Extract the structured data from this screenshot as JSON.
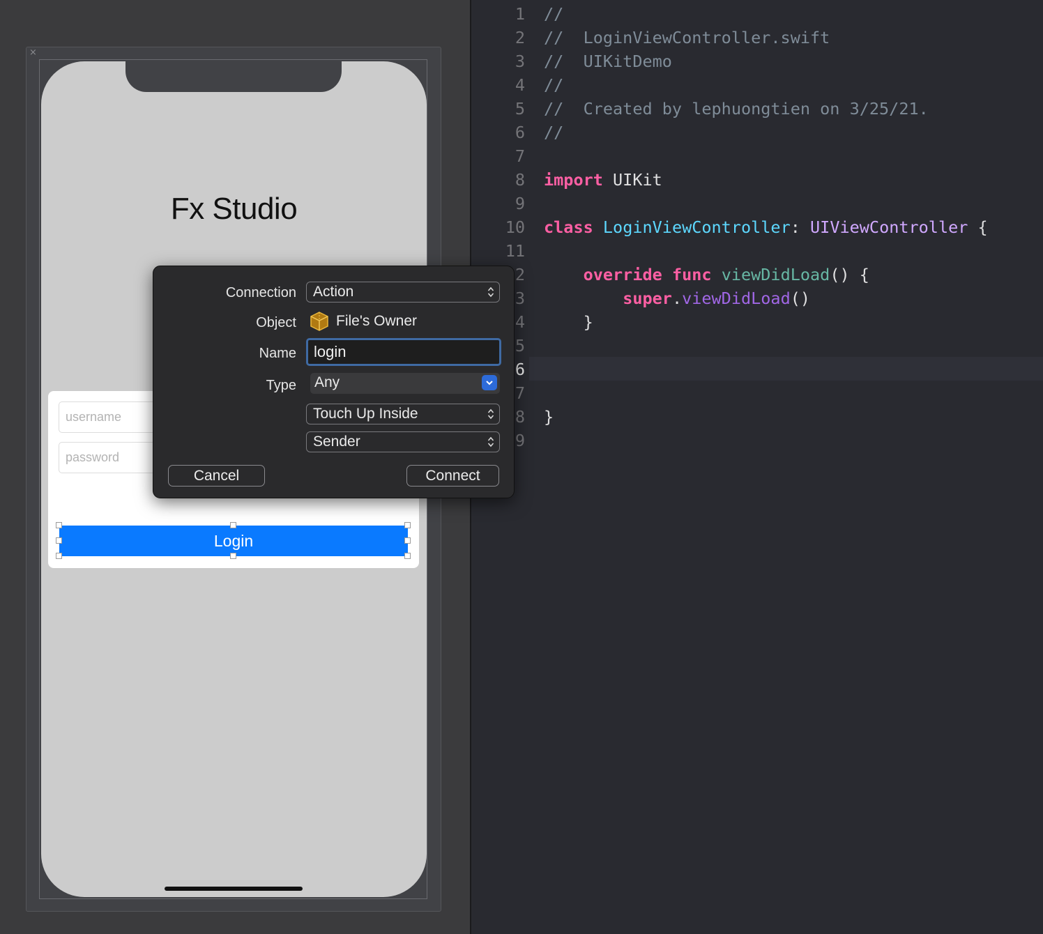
{
  "canvas": {
    "app_title": "Fx Studio",
    "username_placeholder": "username",
    "password_placeholder": "password",
    "login_label": "Login",
    "scene_close_glyph": "×"
  },
  "popover": {
    "connection_label": "Connection",
    "connection_value": "Action",
    "object_label": "Object",
    "object_value": "File's Owner",
    "object_icon": "cube-icon",
    "name_label": "Name",
    "name_value": "login",
    "type_label": "Type",
    "type_value": "Any",
    "event_value": "Touch Up Inside",
    "arguments_value": "Sender",
    "cancel_label": "Cancel",
    "connect_label": "Connect"
  },
  "editor": {
    "line_numbers": [
      "1",
      "2",
      "3",
      "4",
      "5",
      "6",
      "7",
      "8",
      "9",
      "10",
      "11",
      "2",
      "3",
      "4",
      "5",
      "6",
      "7",
      "8",
      "9"
    ],
    "current_line_index": 15,
    "lines": [
      [
        {
          "t": "//",
          "c": "comment"
        }
      ],
      [
        {
          "t": "//  LoginViewController.swift",
          "c": "comment"
        }
      ],
      [
        {
          "t": "//  UIKitDemo",
          "c": "comment"
        }
      ],
      [
        {
          "t": "//",
          "c": "comment"
        }
      ],
      [
        {
          "t": "//  Created by lephuongtien on 3/25/21.",
          "c": "comment"
        }
      ],
      [
        {
          "t": "//",
          "c": "comment"
        }
      ],
      [],
      [
        {
          "t": "import",
          "c": "kw"
        },
        {
          "t": " UIKit",
          "c": "plain"
        }
      ],
      [],
      [
        {
          "t": "class",
          "c": "kw"
        },
        {
          "t": " ",
          "c": "plain"
        },
        {
          "t": "LoginViewController",
          "c": "decl"
        },
        {
          "t": ": ",
          "c": "plain"
        },
        {
          "t": "UIViewController",
          "c": "type"
        },
        {
          "t": " {",
          "c": "plain"
        }
      ],
      [],
      [
        {
          "t": "    ",
          "c": "plain"
        },
        {
          "t": "override",
          "c": "kw"
        },
        {
          "t": " ",
          "c": "plain"
        },
        {
          "t": "func",
          "c": "kw"
        },
        {
          "t": " ",
          "c": "plain"
        },
        {
          "t": "viewDidLoad",
          "c": "func"
        },
        {
          "t": "() {",
          "c": "plain"
        }
      ],
      [
        {
          "t": "        ",
          "c": "plain"
        },
        {
          "t": "super",
          "c": "kw"
        },
        {
          "t": ".",
          "c": "plain"
        },
        {
          "t": "viewDidLoad",
          "c": "method"
        },
        {
          "t": "()",
          "c": "plain"
        }
      ],
      [
        {
          "t": "    }",
          "c": "plain"
        }
      ],
      [],
      [],
      [],
      [
        {
          "t": "}",
          "c": "plain"
        }
      ],
      []
    ]
  },
  "colors": {
    "login_button": "#0a7aff",
    "editor_background": "#292a30",
    "keyword": "#fc5fa3",
    "comment": "#7f8c98",
    "type_name": "#d0a8ff",
    "declaration": "#5dd8ff",
    "name_field_focus": "#3f6aa3"
  }
}
